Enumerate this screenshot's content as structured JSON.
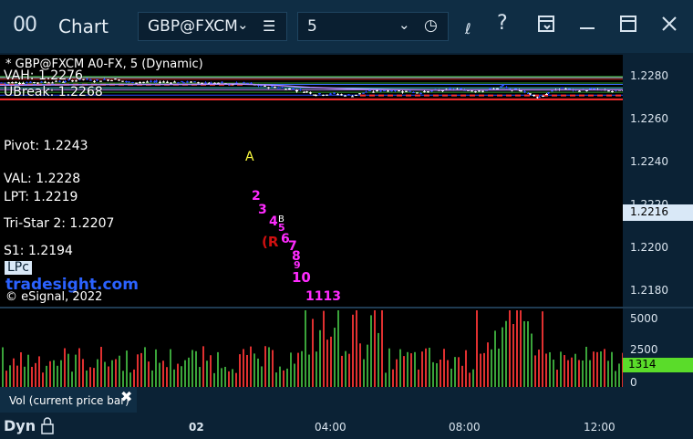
{
  "titlebar": {
    "chart_icon_text": "00",
    "title": "Chart",
    "symbol": "GBP@FXCM",
    "interval": "5"
  },
  "chart": {
    "header": "* GBP@FXCM A0-FX, 5 (Dynamic)",
    "levels": {
      "vah": "VAH: 1.2276",
      "ubreak": "UBreak: 1.2268",
      "pivot": "Pivot: 1.2243",
      "val": "VAL: 1.2228",
      "lpt": "LPT: 1.2219",
      "tristar": "Tri-Star 2: 1.2207",
      "s1": "S1: 1.2194",
      "lpc": "LPc"
    },
    "watermark": "tradesight.com",
    "copyright": "© eSignal, 2022",
    "price_ticks": [
      "1.2280",
      "1.2260",
      "1.2240",
      "1.2220",
      "1.2200",
      "1.2180"
    ],
    "current_price": "1.2216",
    "markers": {
      "a": "A",
      "r": "(R",
      "b": "B",
      "n2": "2",
      "n3": "3",
      "n4": "4",
      "n5": "5",
      "n6": "6",
      "n7": "7",
      "n8": "8",
      "n9": "9",
      "n10": "10",
      "n11": "1113"
    }
  },
  "volume": {
    "legend": "Vol (current price bar)",
    "ticks": [
      "5000",
      "2500",
      "0"
    ],
    "current": "1314"
  },
  "timebar": {
    "mode": "Dyn",
    "ticks": [
      "02",
      "04:00",
      "08:00",
      "12:00"
    ]
  },
  "colors": {
    "candle": "#2b4cff",
    "candle_white": "#ffffff",
    "vol_up": "#3aa33a",
    "vol_down": "#e03030",
    "current_badge": "#d9e8f7",
    "vol_badge": "#5adc2a"
  }
}
